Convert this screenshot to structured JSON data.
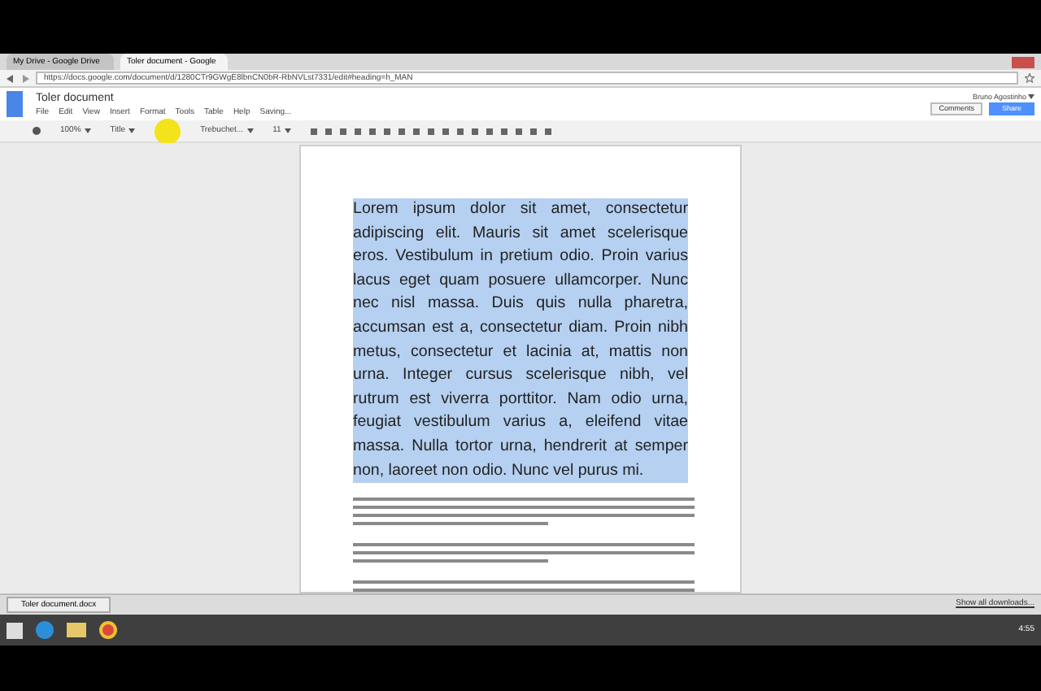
{
  "browser": {
    "tabs": [
      {
        "title": "My Drive - Google Drive",
        "selected": false
      },
      {
        "title": "Toler document - Google",
        "selected": true
      }
    ],
    "url": "https://docs.google.com/document/d/1280CTr9GWgE8lbnCN0bR-RbNVLst7331/edit#heading=h_MAN"
  },
  "docs": {
    "title": "Toler document",
    "menu": [
      "File",
      "Edit",
      "View",
      "Insert",
      "Format",
      "Tools",
      "Table",
      "Help",
      "Saving..."
    ],
    "user": "Bruno Agostinho",
    "comments_button": "Comments",
    "share_button": "Share",
    "toolbar": {
      "zoom": "100%",
      "style": "Title",
      "font": "Trebuchet...",
      "size": "11"
    }
  },
  "document": {
    "paragraphs": [
      {
        "kind": "text",
        "selected": true,
        "text": "Lorem ipsum dolor sit amet, consectetur adipiscing elit. Mauris sit amet scelerisque eros. Vestibulum in pretium odio. Proin varius lacus eget quam posuere ullamcorper. Nunc nec nisl massa. Duis quis nulla pharetra, accumsan est a, consectetur diam. Proin nibh metus, consectetur et lacinia at, mattis non urna. Integer cursus scelerisque nibh, vel rutrum est viverra porttitor. Nam odio urna, feugiat vestibulum varius a, eleifend vitae massa. Nulla tortor urna, hendrerit at semper non, laoreet non odio. Nunc vel purus mi."
      },
      {
        "kind": "blurred"
      },
      {
        "kind": "blurred"
      },
      {
        "kind": "blurred"
      }
    ]
  },
  "downloads": {
    "file": "Toler document.docx",
    "show_all": "Show all downloads..."
  },
  "taskbar": {
    "time": "4:55"
  }
}
